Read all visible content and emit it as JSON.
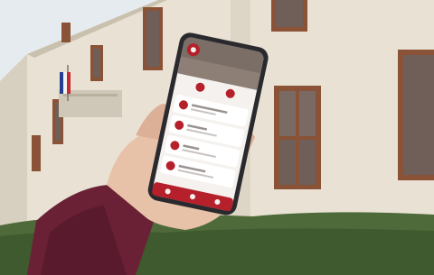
{
  "colors": {
    "facade": "#e9e2d4",
    "facade_shadow": "#d7cfbf",
    "window_frame": "#8a5236",
    "window_glass": "#6f5f58",
    "hedge": "#4f6a3a",
    "sky": "#e6ebf0",
    "sleeve": "#6a2136",
    "skin": "#e8c2a8",
    "phone_body": "#2a2a2e",
    "app_red": "#b5202a",
    "app_bg": "#f4f1ee"
  },
  "phone": {
    "menu_items": [
      {
        "icon": "calendar-icon"
      },
      {
        "icon": "document-icon"
      },
      {
        "icon": "info-icon"
      },
      {
        "icon": "bell-icon"
      }
    ],
    "header_icons": [
      "building-icon",
      "alert-icon"
    ],
    "bottom_nav_icons": [
      "home-icon",
      "search-icon",
      "menu-icon"
    ]
  }
}
